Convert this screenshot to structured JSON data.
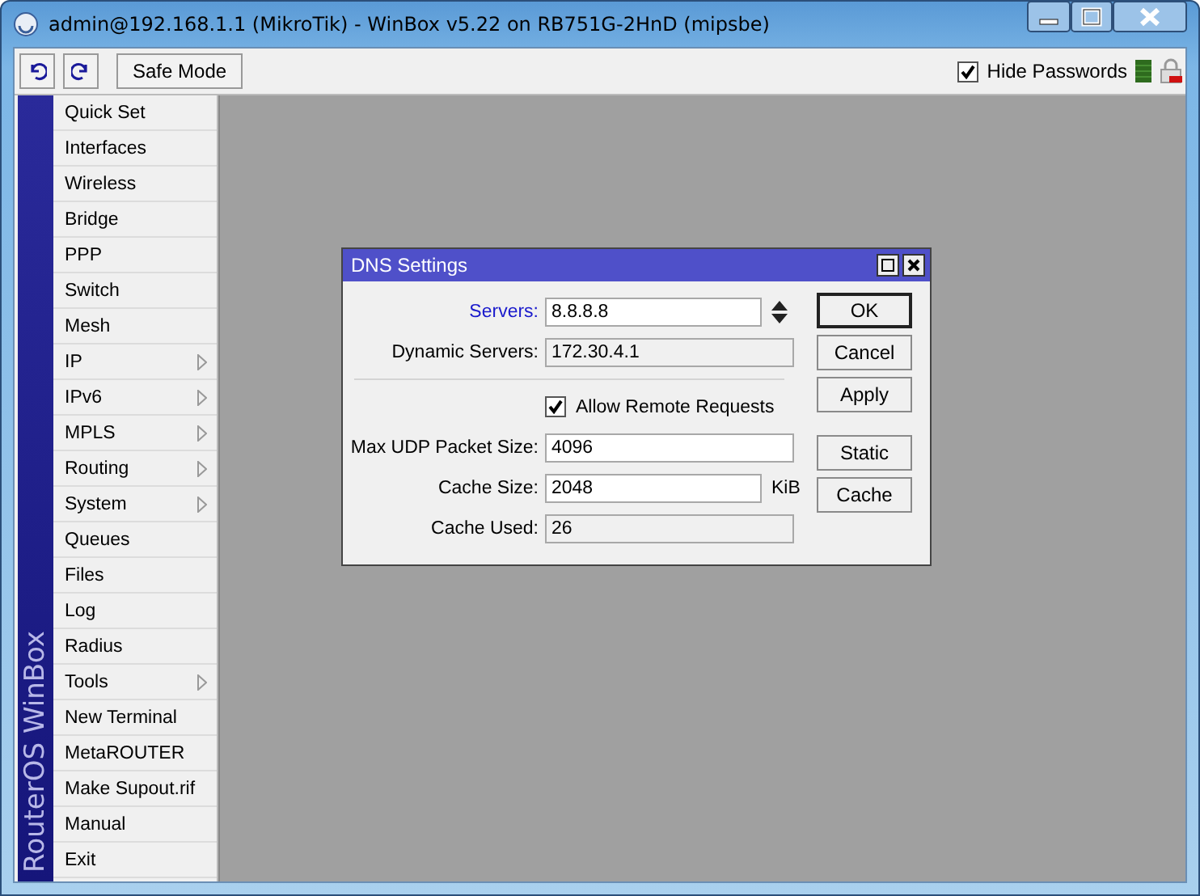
{
  "window": {
    "title": "admin@192.168.1.1 (MikroTik) - WinBox v5.22 on RB751G-2HnD (mipsbe)"
  },
  "toolbar": {
    "safe_mode": "Safe Mode",
    "hide_passwords": {
      "label": "Hide Passwords",
      "checked": true
    }
  },
  "sidebar": {
    "brand": "RouterOS WinBox",
    "items": [
      {
        "label": "Quick Set",
        "submenu": false
      },
      {
        "label": "Interfaces",
        "submenu": false
      },
      {
        "label": "Wireless",
        "submenu": false
      },
      {
        "label": "Bridge",
        "submenu": false
      },
      {
        "label": "PPP",
        "submenu": false
      },
      {
        "label": "Switch",
        "submenu": false
      },
      {
        "label": "Mesh",
        "submenu": false
      },
      {
        "label": "IP",
        "submenu": true
      },
      {
        "label": "IPv6",
        "submenu": true
      },
      {
        "label": "MPLS",
        "submenu": true
      },
      {
        "label": "Routing",
        "submenu": true
      },
      {
        "label": "System",
        "submenu": true
      },
      {
        "label": "Queues",
        "submenu": false
      },
      {
        "label": "Files",
        "submenu": false
      },
      {
        "label": "Log",
        "submenu": false
      },
      {
        "label": "Radius",
        "submenu": false
      },
      {
        "label": "Tools",
        "submenu": true
      },
      {
        "label": "New Terminal",
        "submenu": false
      },
      {
        "label": "MetaROUTER",
        "submenu": false
      },
      {
        "label": "Make Supout.rif",
        "submenu": false
      },
      {
        "label": "Manual",
        "submenu": false
      },
      {
        "label": "Exit",
        "submenu": false
      }
    ]
  },
  "dialog": {
    "title": "DNS Settings",
    "fields": [
      {
        "kind": "list",
        "label": "Servers:",
        "value": "8.8.8.8"
      },
      {
        "kind": "readonly",
        "label": "Dynamic Servers:",
        "value": "172.30.4.1"
      },
      {
        "kind": "separator"
      },
      {
        "kind": "checkbox",
        "label": "Allow Remote Requests",
        "checked": true
      },
      {
        "kind": "editable",
        "label": "Max UDP Packet Size:",
        "value": "4096"
      },
      {
        "kind": "editable",
        "label": "Cache Size:",
        "value": "2048",
        "unit": "KiB"
      },
      {
        "kind": "readonly",
        "label": "Cache Used:",
        "value": "26"
      }
    ],
    "button_groups": [
      [
        {
          "label": "OK",
          "default": true
        },
        {
          "label": "Cancel",
          "default": false
        },
        {
          "label": "Apply",
          "default": false
        }
      ],
      [
        {
          "label": "Static",
          "default": false
        },
        {
          "label": "Cache",
          "default": false
        }
      ]
    ]
  }
}
